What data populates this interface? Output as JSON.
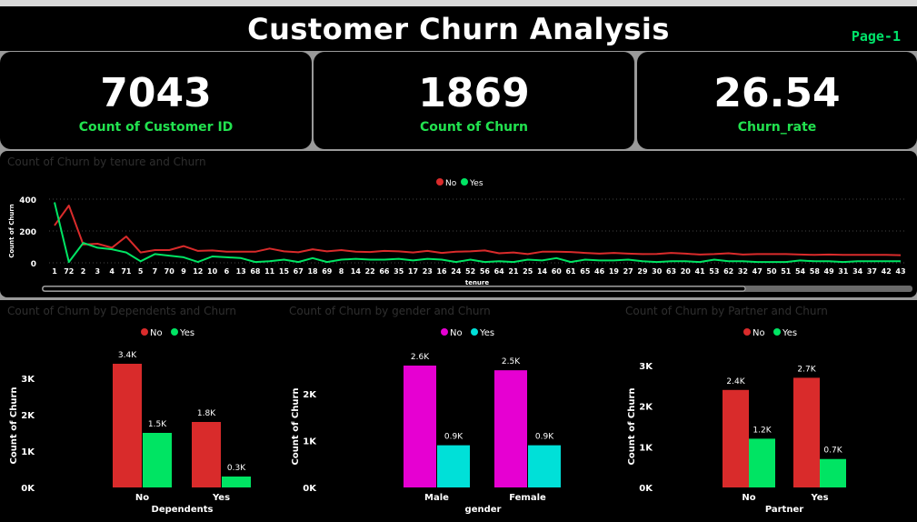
{
  "header": {
    "title": "Customer Churn Analysis",
    "page_label": "Page-1"
  },
  "kpis": [
    {
      "value": "7043",
      "label": "Count of Customer ID"
    },
    {
      "value": "1869",
      "label": "Count of Churn"
    },
    {
      "value": "26.54",
      "label": "Churn_rate"
    }
  ],
  "colors": {
    "no": "#d92b2b",
    "yes": "#00e463",
    "male_no": "#e600d2",
    "female_yes": "#00e0d8",
    "kpi_label": "#22e24f",
    "page_label": "#00e46a"
  },
  "chart_data": [
    {
      "id": "tenure",
      "type": "line",
      "title": "Count of Churn by tenure and Churn",
      "xlabel": "tenure",
      "ylabel": "Count of Churn",
      "ylim": [
        0,
        400
      ],
      "yticks": [
        "0",
        "200",
        "400"
      ],
      "legend_position": "top-center",
      "categories": [
        "1",
        "72",
        "2",
        "3",
        "4",
        "71",
        "5",
        "7",
        "70",
        "9",
        "12",
        "10",
        "6",
        "13",
        "68",
        "11",
        "15",
        "67",
        "18",
        "69",
        "8",
        "14",
        "22",
        "66",
        "35",
        "17",
        "23",
        "16",
        "24",
        "52",
        "56",
        "64",
        "21",
        "25",
        "14",
        "60",
        "61",
        "65",
        "46",
        "19",
        "27",
        "29",
        "30",
        "63",
        "20",
        "41",
        "53",
        "62",
        "32",
        "47",
        "50",
        "51",
        "54",
        "58",
        "49",
        "31",
        "34",
        "37",
        "42",
        "43"
      ],
      "series": [
        {
          "name": "No",
          "values": [
            235,
            360,
            115,
            120,
            95,
            165,
            65,
            80,
            80,
            105,
            75,
            78,
            70,
            70,
            70,
            90,
            72,
            66,
            85,
            72,
            80,
            70,
            68,
            75,
            72,
            65,
            75,
            62,
            70,
            72,
            78,
            60,
            65,
            55,
            70,
            70,
            68,
            62,
            58,
            62,
            58,
            55,
            56,
            62,
            58,
            52,
            55,
            60,
            52,
            55,
            55,
            55,
            52,
            50,
            52,
            50,
            50,
            50,
            50,
            48
          ]
        },
        {
          "name": "Yes",
          "values": [
            380,
            5,
            125,
            95,
            85,
            65,
            10,
            55,
            45,
            35,
            5,
            40,
            35,
            30,
            5,
            10,
            20,
            5,
            30,
            5,
            20,
            25,
            20,
            20,
            25,
            15,
            25,
            20,
            5,
            20,
            5,
            10,
            5,
            20,
            15,
            30,
            5,
            20,
            15,
            15,
            20,
            10,
            5,
            10,
            10,
            5,
            20,
            10,
            10,
            5,
            5,
            5,
            15,
            10,
            10,
            5,
            10,
            10,
            10,
            10
          ]
        }
      ],
      "scrollbar": true
    },
    {
      "id": "dependents",
      "type": "bar",
      "title": "Count of Churn by Dependents and Churn",
      "xlabel": "Dependents",
      "ylabel": "Count of Churn",
      "ylim": [
        0,
        3400
      ],
      "yticks": [
        "0K",
        "1K",
        "2K",
        "3K"
      ],
      "legend_position": "top-center",
      "categories": [
        "No",
        "Yes"
      ],
      "series": [
        {
          "name": "No",
          "values": [
            3400,
            1800
          ],
          "labels": [
            "3.4K",
            "1.8K"
          ]
        },
        {
          "name": "Yes",
          "values": [
            1500,
            300
          ],
          "labels": [
            "1.5K",
            "0.3K"
          ]
        }
      ]
    },
    {
      "id": "gender",
      "type": "bar",
      "title": "Count of Churn by gender and Churn",
      "xlabel": "gender",
      "ylabel": "Count of Churn",
      "ylim": [
        0,
        2600
      ],
      "yticks": [
        "0K",
        "1K",
        "2K"
      ],
      "legend_position": "top-center",
      "categories": [
        "Male",
        "Female"
      ],
      "series": [
        {
          "name": "No",
          "values": [
            2600,
            2500
          ],
          "labels": [
            "2.6K",
            "2.5K"
          ]
        },
        {
          "name": "Yes",
          "values": [
            900,
            900
          ],
          "labels": [
            "0.9K",
            "0.9K"
          ]
        }
      ]
    },
    {
      "id": "partner",
      "type": "bar",
      "title": "Count of Churn by Partner and Churn",
      "xlabel": "Partner",
      "ylabel": "Count of Churn",
      "ylim": [
        0,
        3000
      ],
      "yticks": [
        "0K",
        "1K",
        "2K",
        "3K"
      ],
      "legend_position": "top-center",
      "categories": [
        "No",
        "Yes"
      ],
      "series": [
        {
          "name": "No",
          "values": [
            2400,
            2700
          ],
          "labels": [
            "2.4K",
            "2.7K"
          ]
        },
        {
          "name": "Yes",
          "values": [
            1200,
            700
          ],
          "labels": [
            "1.2K",
            "0.7K"
          ]
        }
      ]
    }
  ]
}
